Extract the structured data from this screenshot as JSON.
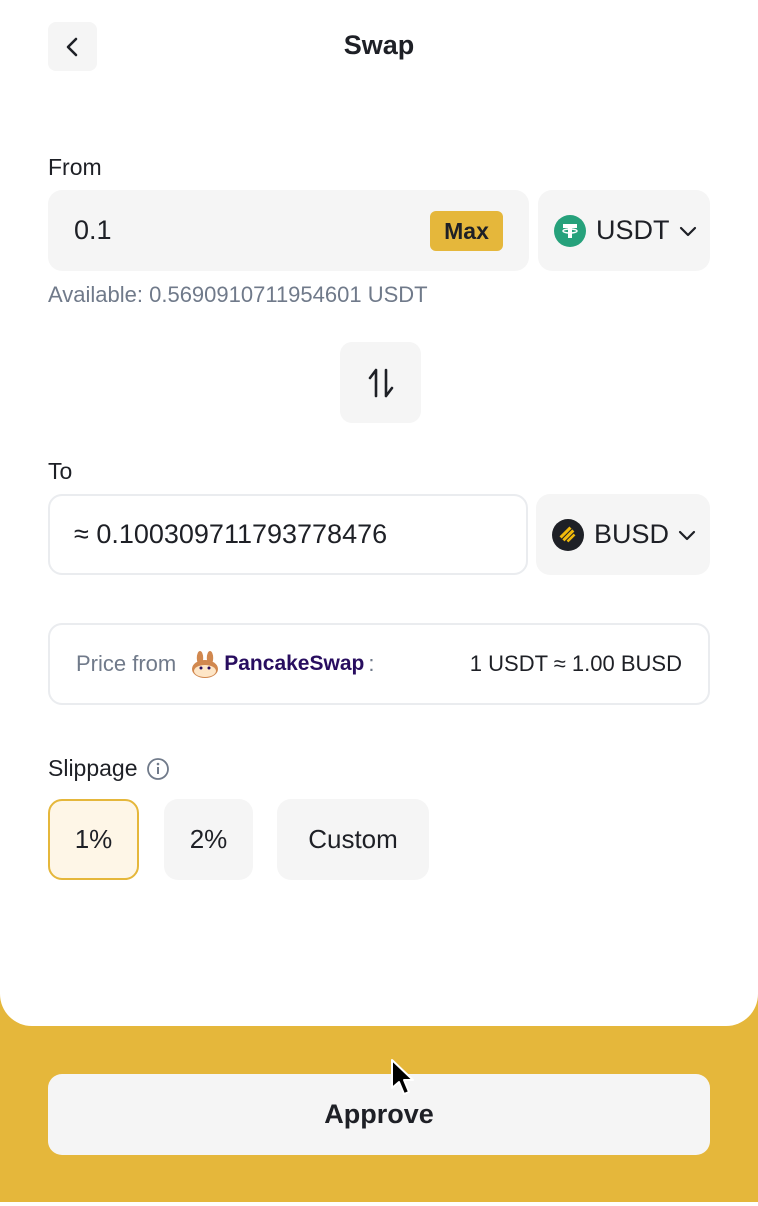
{
  "header": {
    "title": "Swap"
  },
  "from": {
    "label": "From",
    "amount": "0.1",
    "max_label": "Max",
    "token": "USDT",
    "available": "Available: 0.5690910711954601 USDT"
  },
  "to": {
    "label": "To",
    "amount": "≈  0.100309711793778476",
    "token": "BUSD"
  },
  "price": {
    "prefix": "Price from",
    "source": "PancakeSwap",
    "colon": ":",
    "rate": "1 USDT ≈ 1.00 BUSD"
  },
  "slippage": {
    "label": "Slippage",
    "options": [
      "1%",
      "2%",
      "Custom"
    ],
    "selected": "1%"
  },
  "footer": {
    "approve_label": "Approve"
  },
  "icons": {
    "back": "chevron-left-icon",
    "swap": "swap-arrows-icon",
    "usdt": "tether-icon",
    "busd": "busd-icon",
    "info": "info-icon",
    "chevron": "chevron-down-icon"
  },
  "colors": {
    "accent": "#e5b73b",
    "usdt": "#26a17b",
    "busd": "#f0b90b"
  }
}
